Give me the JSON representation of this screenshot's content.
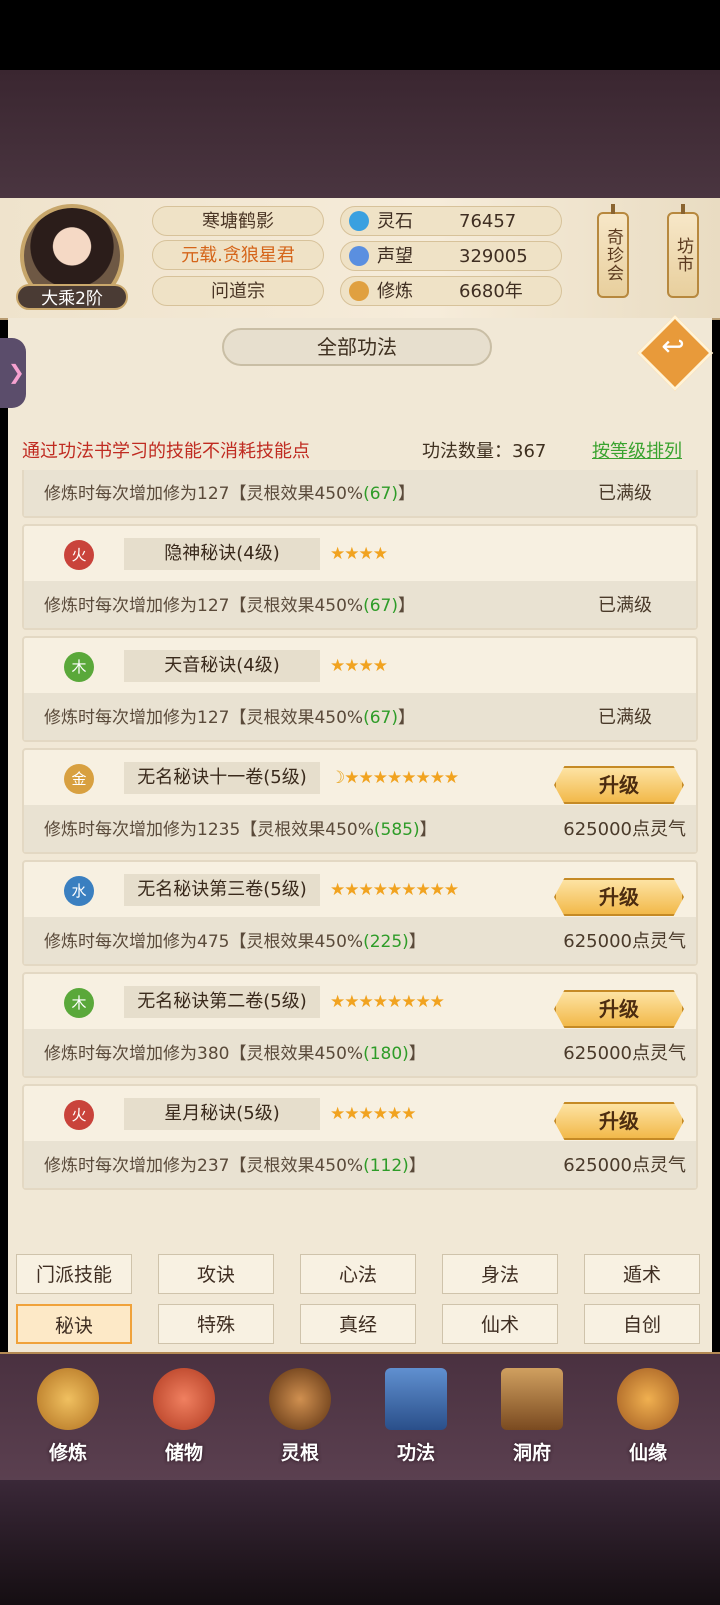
{
  "header": {
    "player_name": "寒塘鹤影",
    "title": "元载.贪狼星君",
    "sect": "问道宗",
    "rank": "大乘2阶",
    "resources": [
      {
        "label": "灵石",
        "value": "76457",
        "icon": "spirit-stone-icon",
        "color": "#3aa0e0"
      },
      {
        "label": "声望",
        "value": "329005",
        "icon": "reputation-icon",
        "color": "#5a8fe0"
      },
      {
        "label": "修炼",
        "value": "6680年",
        "icon": "meditation-icon",
        "color": "#e0a040"
      }
    ],
    "side_buttons": [
      "奇珍会",
      "坊市"
    ]
  },
  "panel": {
    "title": "全部功法",
    "note": "通过功法书学习的技能不消耗技能点",
    "count_label": "功法数量：367",
    "sort_label": "按等级排列"
  },
  "skills": [
    {
      "element": "",
      "name": "",
      "stars": "",
      "desc": "修炼时每次增加修为127【灵根效果450%",
      "bonus": "(67)",
      "desc_end": "】",
      "status": "已满级"
    },
    {
      "element": "火",
      "name": "隐神秘诀(4级)",
      "stars": "★★★★",
      "desc": "修炼时每次增加修为127【灵根效果450%",
      "bonus": "(67)",
      "desc_end": "】",
      "status": "已满级"
    },
    {
      "element": "木",
      "name": "天音秘诀(4级)",
      "stars": "★★★★",
      "desc": "修炼时每次增加修为127【灵根效果450%",
      "bonus": "(67)",
      "desc_end": "】",
      "status": "已满级"
    },
    {
      "element": "金",
      "name": "无名秘诀十一卷(5级)",
      "moon": "☽",
      "stars": "★★★★★★★★",
      "desc": "修炼时每次增加修为1235【灵根效果450%",
      "bonus": "(585)",
      "desc_end": "】",
      "button": "升级",
      "cost": "625000点灵气"
    },
    {
      "element": "水",
      "name": "无名秘诀第三卷(5级)",
      "stars": "★★★★★★★★★",
      "desc": "修炼时每次增加修为475【灵根效果450%",
      "bonus": "(225)",
      "desc_end": "】",
      "button": "升级",
      "cost": "625000点灵气"
    },
    {
      "element": "木",
      "name": "无名秘诀第二卷(5级)",
      "stars": "★★★★★★★★",
      "desc": "修炼时每次增加修为380【灵根效果450%",
      "bonus": "(180)",
      "desc_end": "】",
      "button": "升级",
      "cost": "625000点灵气"
    },
    {
      "element": "火",
      "name": "星月秘诀(5级)",
      "stars": "★★★★★★",
      "desc": "修炼时每次增加修为237【灵根效果450%",
      "bonus": "(112)",
      "desc_end": "】",
      "button": "升级",
      "cost": "625000点灵气"
    }
  ],
  "element_colors": {
    "火": "#c9433b",
    "木": "#5aa83a",
    "金": "#d8a040",
    "水": "#3a7fc0"
  },
  "tabs": [
    "门派技能",
    "攻诀",
    "心法",
    "身法",
    "遁术",
    "秘诀",
    "特殊",
    "真经",
    "仙术",
    "自创"
  ],
  "selected_tab": "秘诀",
  "nav": [
    {
      "label": "修炼",
      "icon": "cultivate-icon",
      "color": "#d8a040"
    },
    {
      "label": "储物",
      "icon": "storage-bag-icon",
      "color": "#d8603a"
    },
    {
      "label": "灵根",
      "icon": "spirit-root-icon",
      "color": "#8a5a30"
    },
    {
      "label": "功法",
      "icon": "skill-book-icon",
      "color": "#3a6fb0"
    },
    {
      "label": "洞府",
      "icon": "cave-house-icon",
      "color": "#b07a40"
    },
    {
      "label": "仙缘",
      "icon": "fate-gourd-icon",
      "color": "#c98a3a"
    }
  ]
}
